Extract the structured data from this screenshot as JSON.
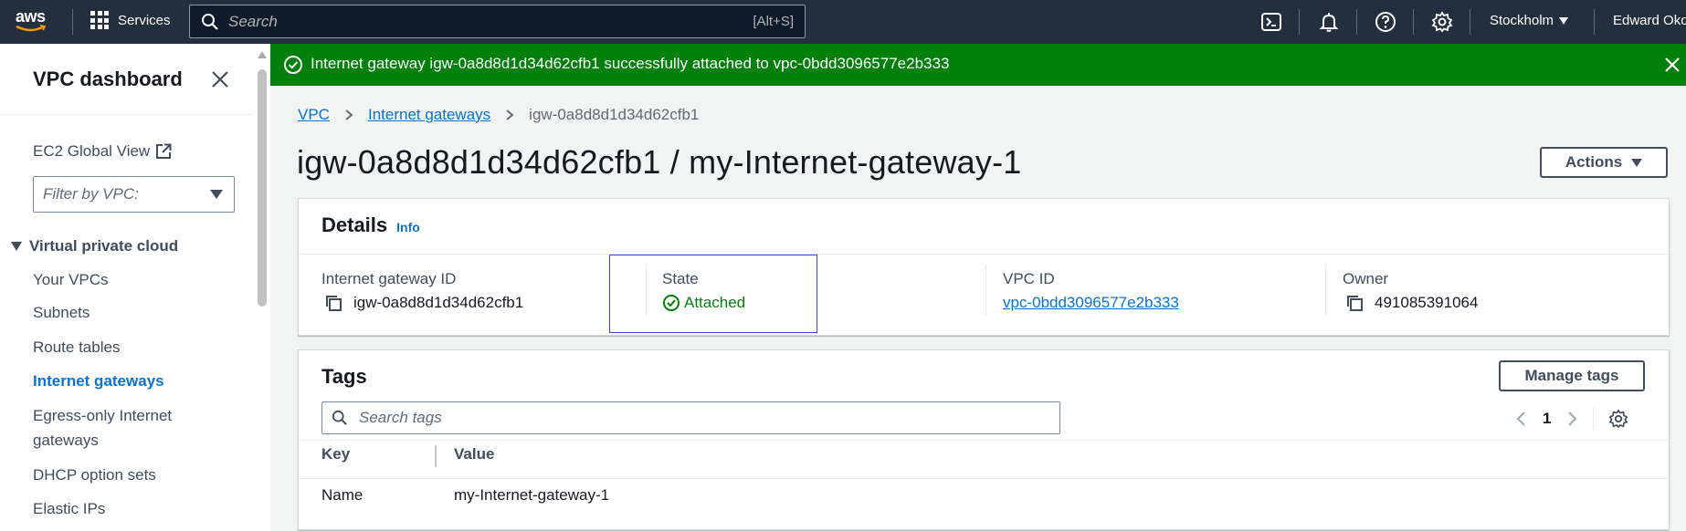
{
  "topbar": {
    "logo_text": "aws",
    "services_label": "Services",
    "search_placeholder": "Search",
    "search_shortcut": "[Alt+S]",
    "region": "Stockholm",
    "user": "Edward Oko"
  },
  "sidebar": {
    "title": "VPC dashboard",
    "ec2_global_view": "EC2 Global View",
    "filter_placeholder": "Filter by VPC:",
    "section": "Virtual private cloud",
    "items": [
      {
        "label": "Your VPCs"
      },
      {
        "label": "Subnets"
      },
      {
        "label": "Route tables"
      },
      {
        "label": "Internet gateways"
      },
      {
        "label": "Egress-only Internet gateways"
      },
      {
        "label": "DHCP option sets"
      },
      {
        "label": "Elastic IPs"
      }
    ]
  },
  "flash": {
    "message": "Internet gateway igw-0a8d8d1d34d62cfb1 successfully attached to vpc-0bdd3096577e2b333",
    "color": "#037f0c"
  },
  "breadcrumb": {
    "items": [
      "VPC",
      "Internet gateways",
      "igw-0a8d8d1d34d62cfb1"
    ]
  },
  "page": {
    "title": "igw-0a8d8d1d34d62cfb1 / my-Internet-gateway-1",
    "actions_label": "Actions"
  },
  "details": {
    "heading": "Details",
    "info": "Info",
    "fields": {
      "igw_label": "Internet gateway ID",
      "igw_value": "igw-0a8d8d1d34d62cfb1",
      "state_label": "State",
      "state_value": "Attached",
      "vpc_label": "VPC ID",
      "vpc_value": "vpc-0bdd3096577e2b333",
      "owner_label": "Owner",
      "owner_value": "491085391064"
    }
  },
  "tags": {
    "heading": "Tags",
    "manage_label": "Manage tags",
    "search_placeholder": "Search tags",
    "page": "1",
    "columns": [
      "Key",
      "Value"
    ],
    "rows": [
      {
        "key": "Name",
        "value": "my-Internet-gateway-1"
      }
    ]
  },
  "colors": {
    "topbar": "#232f3e",
    "link": "#0972d3",
    "success": "#037f0c"
  }
}
